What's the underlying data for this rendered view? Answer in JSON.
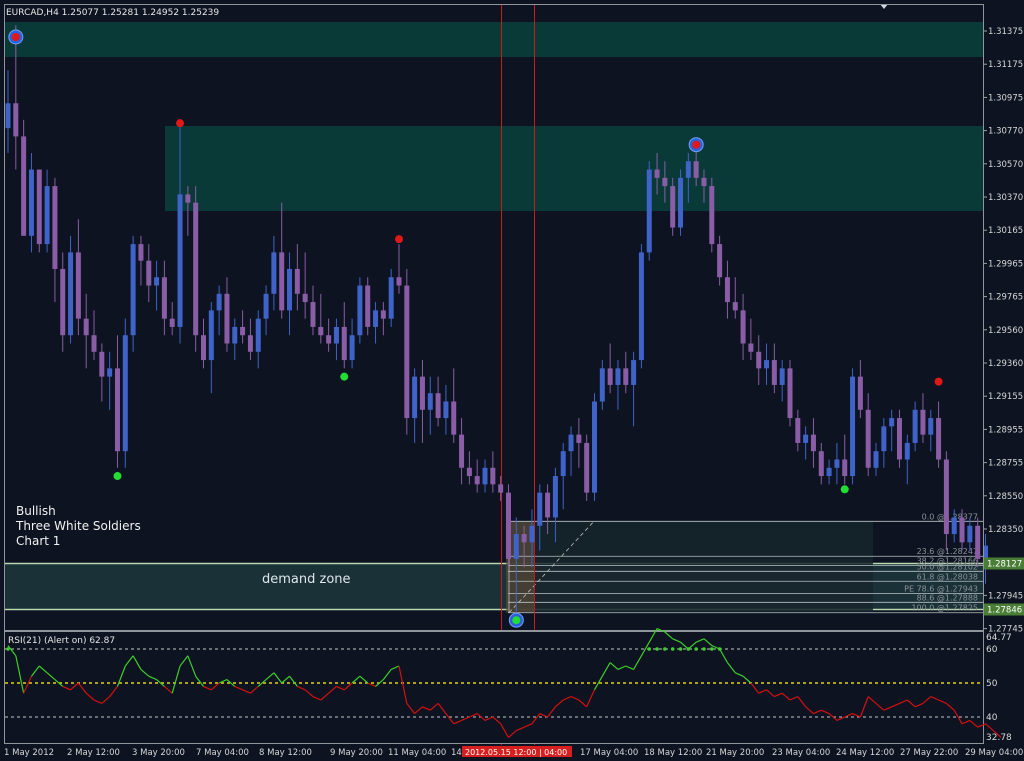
{
  "header": {
    "title": "EURCAD,H4  1.25077 1.25281 1.24952 1.25239"
  },
  "pattern_note": {
    "line1": "Bullish",
    "line2": "Three White Soldiers",
    "line3": "Chart 1"
  },
  "demand_zone": {
    "label": "demand zone"
  },
  "colors": {
    "background": "#0d1320",
    "bull": "#3f63c9",
    "bear": "#8a5da6",
    "zone": "#0a3a37",
    "demand": "#1b3138",
    "rsi_green": "#3ccf2a",
    "rsi_red": "#d41010",
    "signal_top": "#e01818",
    "signal_bottom": "#22dd33"
  },
  "price_axis": {
    "ticks": [
      "1.31375",
      "1.31175",
      "1.30975",
      "1.30770",
      "1.30570",
      "1.30370",
      "1.30165",
      "1.29965",
      "1.29765",
      "1.29560",
      "1.29360",
      "1.29155",
      "1.28955",
      "1.28755",
      "1.28550",
      "1.28350",
      "1.28145",
      "1.27945",
      "1.27745"
    ],
    "badges": [
      {
        "value": "1.28127",
        "color": "#4a7d36"
      },
      {
        "value": "1.27846",
        "color": "#4a7d36"
      }
    ]
  },
  "fibonacci": {
    "levels": [
      {
        "label": "0.0  @1.28377",
        "price": 1.28377
      },
      {
        "label": "23.6  @1.28247",
        "price": 1.28166
      },
      {
        "label": "38.2  @1.28166",
        "price": 1.2811
      },
      {
        "label": "50.0  @1.28102",
        "price": 1.28075
      },
      {
        "label": "61.8  @1.28038",
        "price": 1.28015
      },
      {
        "label": "PE 78.6  @1.27943",
        "price": 1.27942
      },
      {
        "label": "88.6  @1.27888",
        "price": 1.27888
      },
      {
        "label": "100.0  @1.27825",
        "price": 1.27825
      }
    ]
  },
  "rsi": {
    "title": "RSI(21) (Alert on) 62.87",
    "value_label": "64.77",
    "levels": [
      "60",
      "50",
      "40"
    ],
    "min_label": "32.78"
  },
  "time_axis": {
    "labels": [
      "1 May 2012",
      "2 May 12:00",
      "3 May 20:00",
      "7 May 04:00",
      "8 May 12:00",
      "9 May 20:00",
      "11 May 04:00",
      "14",
      "17 May 04:00",
      "18 May 12:00",
      "21 May 20:00",
      "23 May 04:00",
      "24 May 12:00",
      "27 May 22:00",
      "29 May 04:00"
    ],
    "highlight_label": "2012.05.15 12:00 | 04:00"
  },
  "chart_data": {
    "type": "candlestick",
    "symbol": "EURCAD",
    "timeframe": "H4",
    "ylim": [
      1.27745,
      1.31475
    ],
    "candles": [
      [
        1.3075,
        1.311,
        1.306,
        1.309
      ],
      [
        1.309,
        1.3137,
        1.305,
        1.307
      ],
      [
        1.307,
        1.308,
        1.301,
        1.301
      ],
      [
        1.301,
        1.306,
        1.3,
        1.305
      ],
      [
        1.305,
        1.305,
        1.3,
        1.3005
      ],
      [
        1.3005,
        1.305,
        1.3,
        1.304
      ],
      [
        1.304,
        1.3045,
        1.297,
        1.299
      ],
      [
        1.299,
        1.3,
        1.294,
        1.295
      ],
      [
        1.295,
        1.301,
        1.2945,
        1.3
      ],
      [
        1.3,
        1.302,
        1.295,
        1.296
      ],
      [
        1.296,
        1.2975,
        1.293,
        1.295
      ],
      [
        1.295,
        1.2965,
        1.2935,
        1.294
      ],
      [
        1.294,
        1.2945,
        1.291,
        1.2925
      ],
      [
        1.2925,
        1.294,
        1.2905,
        1.293
      ],
      [
        1.293,
        1.295,
        1.287,
        1.288
      ],
      [
        1.288,
        1.296,
        1.287,
        1.295
      ],
      [
        1.295,
        1.301,
        1.294,
        1.3005
      ],
      [
        1.3005,
        1.301,
        1.298,
        1.2995
      ],
      [
        1.2995,
        1.3005,
        1.297,
        1.298
      ],
      [
        1.298,
        1.2995,
        1.2965,
        1.2985
      ],
      [
        1.2985,
        1.2995,
        1.295,
        1.296
      ],
      [
        1.296,
        1.297,
        1.295,
        1.2955
      ],
      [
        1.2955,
        1.3077,
        1.2945,
        1.3035
      ],
      [
        1.3035,
        1.304,
        1.301,
        1.303
      ],
      [
        1.303,
        1.304,
        1.294,
        1.295
      ],
      [
        1.295,
        1.296,
        1.293,
        1.2935
      ],
      [
        1.2935,
        1.297,
        1.2915,
        1.2965
      ],
      [
        1.2965,
        1.298,
        1.295,
        1.2975
      ],
      [
        1.2975,
        1.2985,
        1.294,
        1.2945
      ],
      [
        1.2945,
        1.296,
        1.2935,
        1.2955
      ],
      [
        1.2955,
        1.2965,
        1.2945,
        1.295
      ],
      [
        1.295,
        1.296,
        1.2935,
        1.294
      ],
      [
        1.294,
        1.2965,
        1.293,
        1.296
      ],
      [
        1.296,
        1.298,
        1.295,
        1.2975
      ],
      [
        1.2975,
        1.301,
        1.2965,
        1.3
      ],
      [
        1.3,
        1.303,
        1.296,
        1.2965
      ],
      [
        1.2965,
        1.3,
        1.295,
        1.299
      ],
      [
        1.299,
        1.3005,
        1.2965,
        1.2975
      ],
      [
        1.2975,
        1.3,
        1.296,
        1.297
      ],
      [
        1.297,
        1.298,
        1.295,
        1.2955
      ],
      [
        1.2955,
        1.2975,
        1.2945,
        1.295
      ],
      [
        1.295,
        1.296,
        1.294,
        1.2945
      ],
      [
        1.2945,
        1.296,
        1.2935,
        1.2955
      ],
      [
        1.2955,
        1.297,
        1.293,
        1.2935
      ],
      [
        1.2935,
        1.296,
        1.293,
        1.295
      ],
      [
        1.295,
        1.2985,
        1.2945,
        1.298
      ],
      [
        1.298,
        1.2985,
        1.295,
        1.2955
      ],
      [
        1.2955,
        1.297,
        1.2945,
        1.2965
      ],
      [
        1.2965,
        1.297,
        1.295,
        1.296
      ],
      [
        1.296,
        1.299,
        1.2955,
        1.2985
      ],
      [
        1.2985,
        1.3005,
        1.2975,
        1.298
      ],
      [
        1.298,
        1.299,
        1.289,
        1.29
      ],
      [
        1.29,
        1.293,
        1.2885,
        1.2925
      ],
      [
        1.2925,
        1.2935,
        1.2885,
        1.2905
      ],
      [
        1.2905,
        1.2925,
        1.289,
        1.2915
      ],
      [
        1.2915,
        1.2925,
        1.2895,
        1.29
      ],
      [
        1.29,
        1.292,
        1.289,
        1.291
      ],
      [
        1.291,
        1.293,
        1.2885,
        1.289
      ],
      [
        1.289,
        1.29,
        1.286,
        1.287
      ],
      [
        1.287,
        1.288,
        1.286,
        1.2865
      ],
      [
        1.2865,
        1.2875,
        1.2855,
        1.286
      ],
      [
        1.286,
        1.2875,
        1.2855,
        1.287
      ],
      [
        1.287,
        1.288,
        1.2855,
        1.286
      ],
      [
        1.286,
        1.2865,
        1.285,
        1.2855
      ],
      [
        1.2855,
        1.286,
        1.281,
        1.2815
      ],
      [
        1.2815,
        1.284,
        1.278,
        1.283
      ],
      [
        1.283,
        1.2835,
        1.281,
        1.2825
      ],
      [
        1.2825,
        1.2845,
        1.281,
        1.2835
      ],
      [
        1.2835,
        1.286,
        1.282,
        1.2855
      ],
      [
        1.2855,
        1.286,
        1.283,
        1.284
      ],
      [
        1.284,
        1.287,
        1.2825,
        1.2865
      ],
      [
        1.2865,
        1.2885,
        1.2845,
        1.288
      ],
      [
        1.288,
        1.2895,
        1.2865,
        1.289
      ],
      [
        1.289,
        1.29,
        1.287,
        1.2885
      ],
      [
        1.2885,
        1.289,
        1.285,
        1.2855
      ],
      [
        1.2855,
        1.2915,
        1.285,
        1.291
      ],
      [
        1.291,
        1.2935,
        1.2905,
        1.293
      ],
      [
        1.293,
        1.2945,
        1.2915,
        1.292
      ],
      [
        1.292,
        1.2935,
        1.2905,
        1.293
      ],
      [
        1.293,
        1.294,
        1.2915,
        1.292
      ],
      [
        1.292,
        1.294,
        1.2895,
        1.2935
      ],
      [
        1.2935,
        1.3005,
        1.293,
        1.3
      ],
      [
        1.3,
        1.3055,
        1.2995,
        1.305
      ],
      [
        1.305,
        1.306,
        1.3035,
        1.3045
      ],
      [
        1.3045,
        1.3055,
        1.303,
        1.304
      ],
      [
        1.304,
        1.3045,
        1.301,
        1.3015
      ],
      [
        1.3015,
        1.305,
        1.301,
        1.3045
      ],
      [
        1.3045,
        1.306,
        1.303,
        1.3055
      ],
      [
        1.3055,
        1.3065,
        1.304,
        1.3045
      ],
      [
        1.3045,
        1.305,
        1.303,
        1.304
      ],
      [
        1.304,
        1.3045,
        1.3,
        1.3005
      ],
      [
        1.3005,
        1.301,
        1.298,
        1.2985
      ],
      [
        1.2985,
        1.2995,
        1.296,
        1.297
      ],
      [
        1.297,
        1.2985,
        1.296,
        1.2965
      ],
      [
        1.2965,
        1.2975,
        1.2935,
        1.2945
      ],
      [
        1.2945,
        1.296,
        1.2935,
        1.294
      ],
      [
        1.294,
        1.295,
        1.292,
        1.293
      ],
      [
        1.293,
        1.2945,
        1.292,
        1.2935
      ],
      [
        1.2935,
        1.2945,
        1.2915,
        1.292
      ],
      [
        1.292,
        1.2935,
        1.291,
        1.293
      ],
      [
        1.293,
        1.2935,
        1.2895,
        1.29
      ],
      [
        1.29,
        1.2905,
        1.288,
        1.2885
      ],
      [
        1.2885,
        1.2895,
        1.2875,
        1.289
      ],
      [
        1.289,
        1.29,
        1.287,
        1.288
      ],
      [
        1.288,
        1.2885,
        1.286,
        1.2865
      ],
      [
        1.2865,
        1.2875,
        1.286,
        1.287
      ],
      [
        1.287,
        1.2885,
        1.286,
        1.2875
      ],
      [
        1.2875,
        1.289,
        1.286,
        1.2865
      ],
      [
        1.2865,
        1.293,
        1.286,
        1.2925
      ],
      [
        1.2925,
        1.2935,
        1.29,
        1.2905
      ],
      [
        1.2905,
        1.2915,
        1.2865,
        1.287
      ],
      [
        1.287,
        1.2885,
        1.2865,
        1.288
      ],
      [
        1.288,
        1.29,
        1.287,
        1.2895
      ],
      [
        1.2895,
        1.2905,
        1.288,
        1.29
      ],
      [
        1.29,
        1.2905,
        1.287,
        1.2875
      ],
      [
        1.2875,
        1.289,
        1.286,
        1.2885
      ],
      [
        1.2885,
        1.291,
        1.288,
        1.2905
      ],
      [
        1.2905,
        1.2915,
        1.2885,
        1.289
      ],
      [
        1.289,
        1.2905,
        1.288,
        1.29
      ],
      [
        1.29,
        1.291,
        1.287,
        1.2875
      ],
      [
        1.2875,
        1.288,
        1.282,
        1.283
      ],
      [
        1.283,
        1.2845,
        1.2825,
        1.284
      ],
      [
        1.284,
        1.2845,
        1.282,
        1.2825
      ],
      [
        1.2825,
        1.284,
        1.282,
        1.2835
      ],
      [
        1.2835,
        1.284,
        1.281,
        1.2815
      ],
      [
        1.2815,
        1.283,
        1.28,
        1.2823
      ]
    ],
    "rsi_values": [
      61,
      58,
      47,
      52,
      55,
      53,
      51,
      49,
      48,
      50,
      47,
      45,
      44,
      46,
      49,
      55,
      58,
      54,
      52,
      51,
      49,
      47,
      55,
      58,
      52,
      49,
      48,
      50,
      51,
      49,
      48,
      47,
      49,
      51,
      53,
      50,
      52,
      49,
      48,
      46,
      45,
      47,
      49,
      48,
      50,
      52,
      50,
      49,
      51,
      54,
      55,
      44,
      41,
      43,
      42,
      44,
      41,
      38,
      39,
      40,
      41,
      39,
      40,
      38,
      34,
      36,
      37,
      38,
      41,
      40,
      43,
      45,
      46,
      45,
      43,
      48,
      52,
      56,
      54,
      55,
      54,
      58,
      62,
      66,
      65,
      63,
      62,
      60,
      62,
      63,
      61,
      60,
      56,
      53,
      52,
      50,
      47,
      48,
      46,
      47,
      45,
      46,
      43,
      41,
      42,
      41,
      39,
      40,
      41,
      40,
      46,
      44,
      42,
      43,
      44,
      45,
      43,
      44,
      46,
      45,
      44,
      42,
      38,
      39,
      37,
      38,
      36,
      34
    ],
    "signals_top": [
      {
        "candle": 1,
        "price": 1.313
      },
      {
        "candle": 22,
        "price": 1.3078
      },
      {
        "candle": 50,
        "price": 1.3008
      },
      {
        "candle": 88,
        "price": 1.3065
      },
      {
        "candle": 119,
        "price": 1.2922
      }
    ],
    "signals_bottom": [
      {
        "candle": 14,
        "price": 1.2865
      },
      {
        "candle": 43,
        "price": 1.2925
      },
      {
        "candle": 65,
        "price": 1.2778
      },
      {
        "candle": 107,
        "price": 1.2857
      }
    ],
    "circled_points": [
      {
        "candle": 1,
        "price": 1.313
      },
      {
        "candle": 65,
        "price": 1.2778
      },
      {
        "candle": 88,
        "price": 1.3065
      }
    ],
    "supply_zones": [
      [
        1.3126,
        1.3137
      ],
      [
        1.3032,
        1.3077
      ]
    ],
    "demand_zone_range": [
      1.27846,
      1.28127
    ]
  }
}
